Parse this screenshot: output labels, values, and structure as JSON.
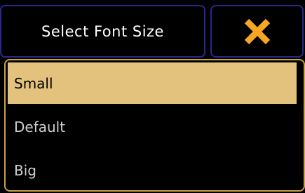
{
  "dialog": {
    "title": "Select Font Size",
    "close_icon": "close-x-icon",
    "colors": {
      "background": "#000000",
      "title_border": "#27278f",
      "list_border": "#c9a23a",
      "selected_bg": "#e3c27d",
      "close_icon": "#f5a623"
    }
  },
  "options": [
    {
      "label": "Small",
      "selected": true
    },
    {
      "label": "Default",
      "selected": false
    },
    {
      "label": "Big",
      "selected": false
    }
  ]
}
